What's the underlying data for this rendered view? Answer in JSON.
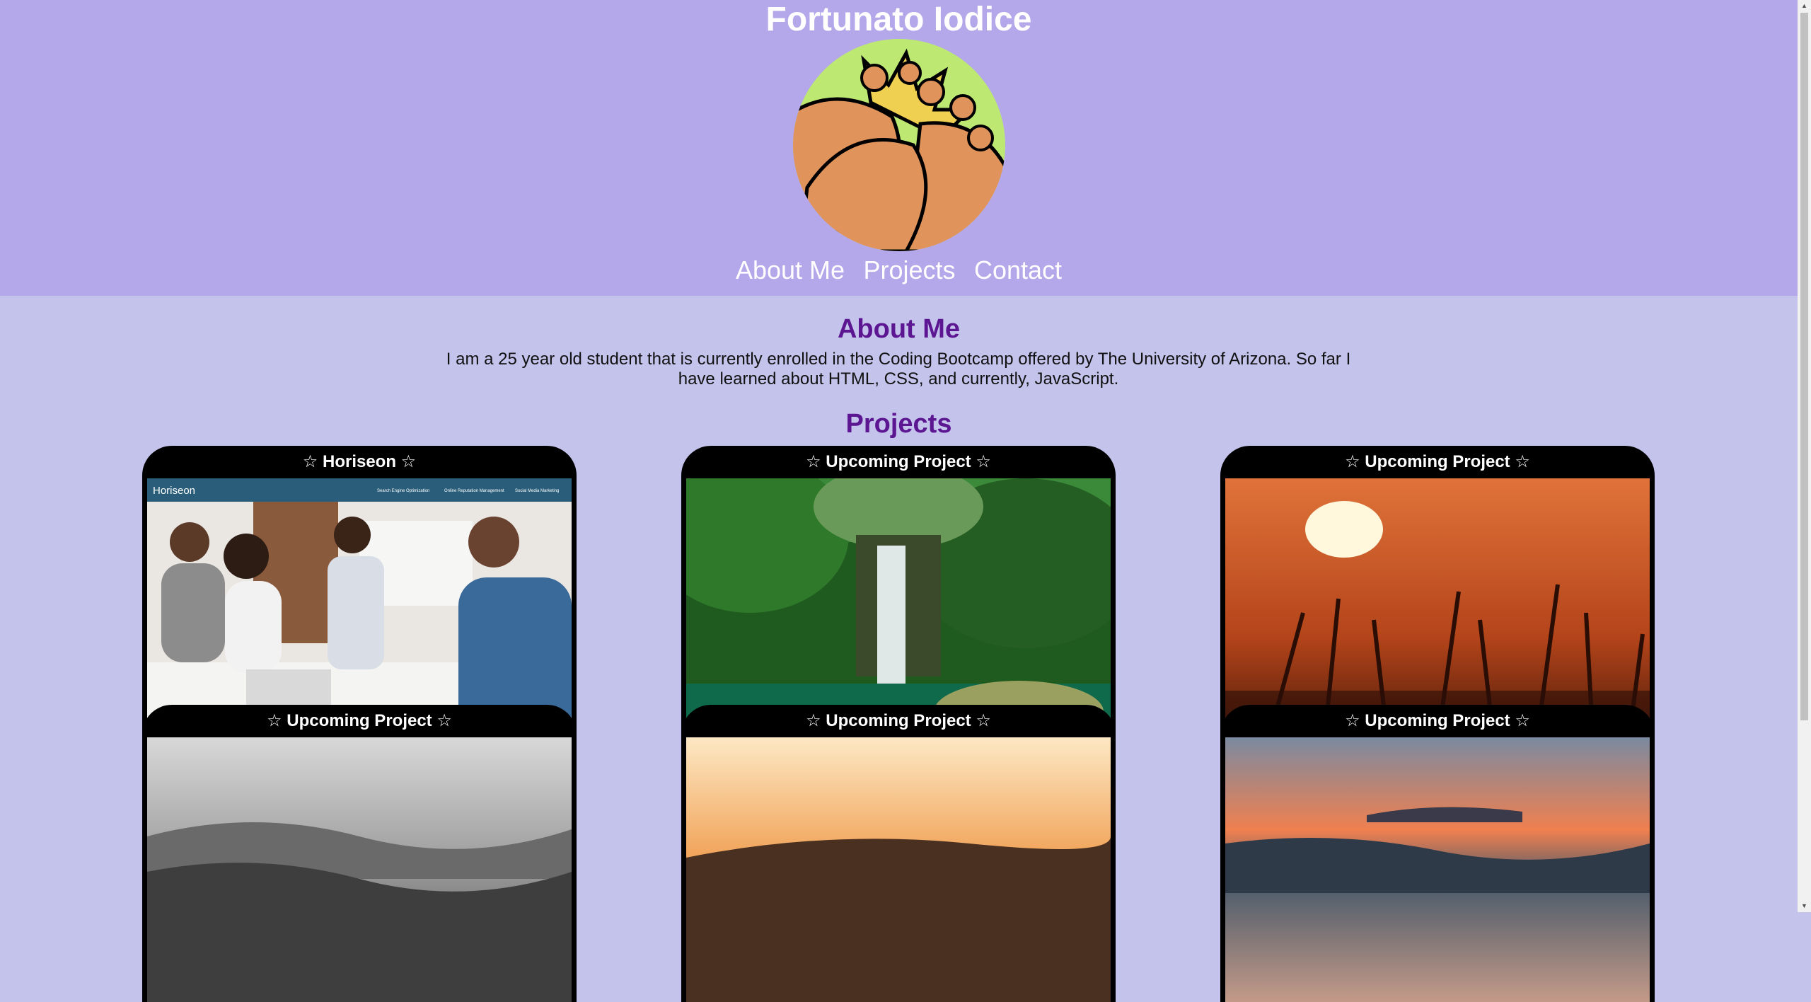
{
  "header": {
    "title": "Fortunato Iodice"
  },
  "nav": {
    "items": [
      "About Me",
      "Projects",
      "Contact"
    ]
  },
  "about": {
    "heading": "About Me",
    "text": "I am a 25 year old student that is currently enrolled in the Coding Bootcamp offered by The University of Arizona. So far I have learned about HTML, CSS, and currently, JavaScript."
  },
  "projects": {
    "heading": "Projects",
    "cards": [
      {
        "title": "☆ Horiseon ☆",
        "image": "horiseon-screenshot"
      },
      {
        "title": "☆ Upcoming Project ☆",
        "image": "waterfall-photo"
      },
      {
        "title": "☆ Upcoming Project ☆",
        "image": "sunset-wheat-photo"
      },
      {
        "title": "☆ Upcoming Project ☆",
        "image": "stormy-sea-photo"
      },
      {
        "title": "☆ Upcoming Project ☆",
        "image": "sunset-clouds-photo"
      },
      {
        "title": "☆ Upcoming Project ☆",
        "image": "ocean-sunset-photo"
      }
    ]
  },
  "horiseon_preview": {
    "brand": "Horiseon",
    "links": [
      "Search Engine Optimization",
      "Online Reputation Management",
      "Social Media Marketing"
    ]
  },
  "colors": {
    "header_bg": "#b4a7ea",
    "page_bg": "#c4c3ec",
    "heading": "#5c1691",
    "card_bg": "#000000"
  }
}
